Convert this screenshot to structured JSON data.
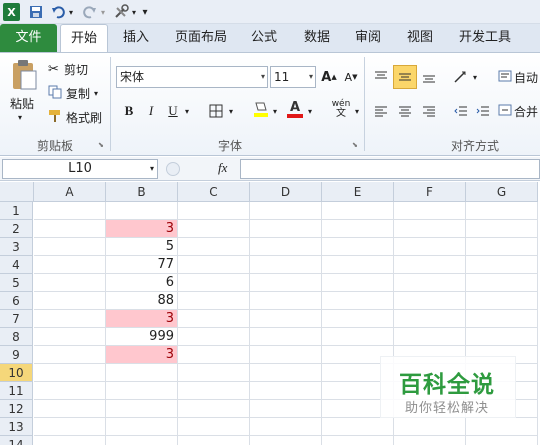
{
  "qat": {
    "excel_icon": "X",
    "save_icon": "save-icon",
    "undo_icon": "undo-icon",
    "redo_icon": "redo-icon",
    "tools_icon": "tools-icon",
    "customize": "▾"
  },
  "tabs": [
    "文件",
    "开始",
    "插入",
    "页面布局",
    "公式",
    "数据",
    "审阅",
    "视图",
    "开发工具"
  ],
  "ribbon": {
    "clipboard": {
      "paste": "粘贴",
      "cut": "剪切",
      "copy": "复制",
      "format_painter": "格式刷",
      "label": "剪贴板"
    },
    "font": {
      "name": "宋体",
      "size": "11",
      "bold": "B",
      "italic": "I",
      "underline": "U",
      "grow": "A",
      "shrink": "A",
      "font_color": "A",
      "wen": "wén",
      "label": "字体"
    },
    "alignment": {
      "label": "对齐方式",
      "wrap": "自动",
      "merge": "合并"
    }
  },
  "formula_bar": {
    "name_box": "L10",
    "fx": "fx",
    "value": ""
  },
  "columns": [
    "A",
    "B",
    "C",
    "D",
    "E",
    "F",
    "G"
  ],
  "rows": [
    "1",
    "2",
    "3",
    "4",
    "5",
    "6",
    "7",
    "8",
    "9",
    "10",
    "11",
    "12",
    "13",
    "14"
  ],
  "selected_row": "10",
  "cells_b": [
    {
      "row": "2",
      "value": "3",
      "dup": true
    },
    {
      "row": "3",
      "value": "5",
      "dup": false
    },
    {
      "row": "4",
      "value": "77",
      "dup": false
    },
    {
      "row": "5",
      "value": "6",
      "dup": false
    },
    {
      "row": "6",
      "value": "88",
      "dup": false
    },
    {
      "row": "7",
      "value": "3",
      "dup": true
    },
    {
      "row": "8",
      "value": "999",
      "dup": false
    },
    {
      "row": "9",
      "value": "3",
      "dup": true
    }
  ],
  "watermark": {
    "title": "百科全说",
    "subtitle": "助你轻松解决"
  },
  "colors": {
    "duplicate_fill": "#ffc7ce",
    "duplicate_text": "#9c0006",
    "file_tab": "#2e8b3e",
    "selected_row": "#f5d77a",
    "watermark_red": "#d9312b",
    "watermark_green": "#2e9b3f"
  }
}
